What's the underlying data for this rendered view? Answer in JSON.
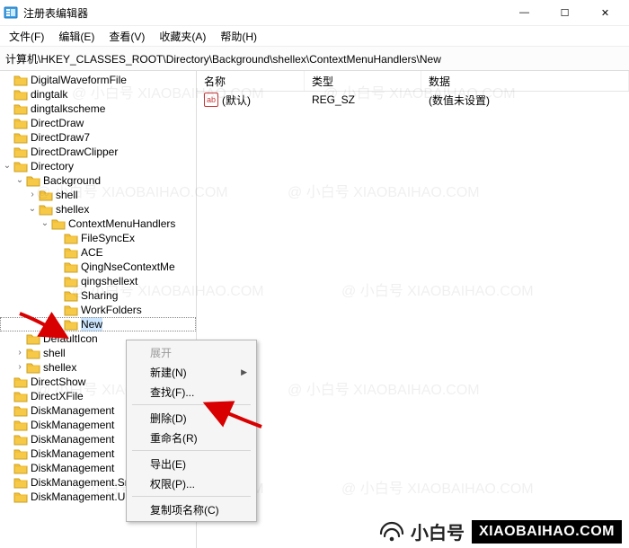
{
  "window": {
    "title": "注册表编辑器",
    "min": "—",
    "max": "☐",
    "close": "✕"
  },
  "menus": {
    "file": "文件(F)",
    "edit": "编辑(E)",
    "view": "查看(V)",
    "fav": "收藏夹(A)",
    "help": "帮助(H)"
  },
  "address": "计算机\\HKEY_CLASSES_ROOT\\Directory\\Background\\shellex\\ContextMenuHandlers\\New",
  "columns": {
    "name": "名称",
    "type": "类型",
    "data": "数据"
  },
  "value_row": {
    "icon": "ab",
    "name": "(默认)",
    "type": "REG_SZ",
    "data": "(数值未设置)"
  },
  "tree": [
    {
      "depth": 0,
      "label": "DigitalWaveformFile"
    },
    {
      "depth": 0,
      "label": "dingtalk"
    },
    {
      "depth": 0,
      "label": "dingtalkscheme"
    },
    {
      "depth": 0,
      "label": "DirectDraw"
    },
    {
      "depth": 0,
      "label": "DirectDraw7"
    },
    {
      "depth": 0,
      "label": "DirectDrawClipper"
    },
    {
      "depth": 0,
      "label": "Directory",
      "toggle": "expanded"
    },
    {
      "depth": 1,
      "label": "Background",
      "toggle": "expanded"
    },
    {
      "depth": 2,
      "label": "shell",
      "toggle": "collapsed"
    },
    {
      "depth": 2,
      "label": "shellex",
      "toggle": "expanded"
    },
    {
      "depth": 3,
      "label": "ContextMenuHandlers",
      "toggle": "expanded"
    },
    {
      "depth": 4,
      "label": "FileSyncEx"
    },
    {
      "depth": 4,
      "label": "ACE"
    },
    {
      "depth": 4,
      "label": "QingNseContextMe"
    },
    {
      "depth": 4,
      "label": "qingshellext"
    },
    {
      "depth": 4,
      "label": "Sharing"
    },
    {
      "depth": 4,
      "label": "WorkFolders"
    },
    {
      "depth": 4,
      "label": "New",
      "selected": true
    },
    {
      "depth": 1,
      "label": "DefaultIcon"
    },
    {
      "depth": 1,
      "label": "shell",
      "toggle": "collapsed"
    },
    {
      "depth": 1,
      "label": "shellex",
      "toggle": "collapsed"
    },
    {
      "depth": 0,
      "label": "DirectShow"
    },
    {
      "depth": 0,
      "label": "DirectXFile"
    },
    {
      "depth": 0,
      "label": "DiskManagement"
    },
    {
      "depth": 0,
      "label": "DiskManagement"
    },
    {
      "depth": 0,
      "label": "DiskManagement"
    },
    {
      "depth": 0,
      "label": "DiskManagement"
    },
    {
      "depth": 0,
      "label": "DiskManagement"
    },
    {
      "depth": 0,
      "label": "DiskManagement.SnapInExtens"
    },
    {
      "depth": 0,
      "label": "DiskManagement.UITasks"
    }
  ],
  "context_menu": {
    "expand": {
      "label": "展开",
      "disabled": true
    },
    "new": {
      "label": "新建(N)",
      "submenu": true
    },
    "find": {
      "label": "查找(F)...",
      "disabled": false
    },
    "delete": {
      "label": "删除(D)",
      "disabled": false
    },
    "rename": {
      "label": "重命名(R)",
      "disabled": false
    },
    "export": {
      "label": "导出(E)",
      "disabled": false
    },
    "perm": {
      "label": "权限(P)...",
      "disabled": false
    },
    "copykey": {
      "label": "复制项名称(C)",
      "disabled": false
    }
  },
  "branding": {
    "logo_text": "小白号",
    "domain": "XIAOBAIHAO.COM",
    "watermark": "@ 小白号  XIAOBAIHAO.COM"
  }
}
